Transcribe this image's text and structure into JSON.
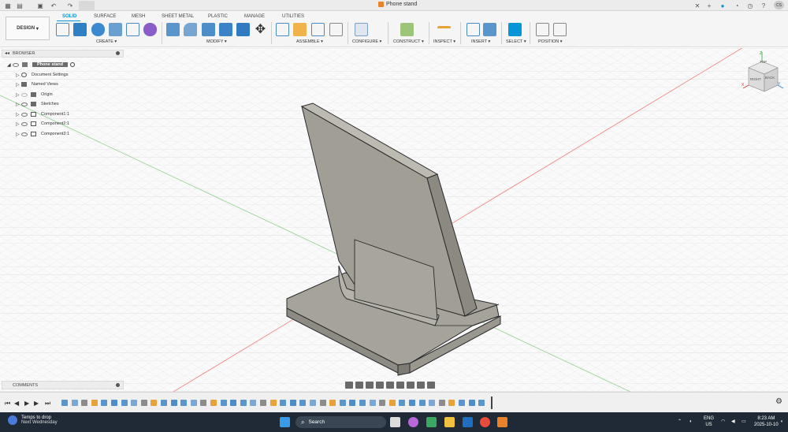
{
  "window": {
    "doc_title": "Phone stand",
    "user_initials": "CS"
  },
  "toolbar": {
    "workspace": "DESIGN",
    "tabs": [
      {
        "label": "SOLID",
        "active": true
      },
      {
        "label": "SURFACE"
      },
      {
        "label": "MESH"
      },
      {
        "label": "SHEET METAL"
      },
      {
        "label": "PLASTIC"
      },
      {
        "label": "MANAGE"
      },
      {
        "label": "UTILITIES"
      }
    ],
    "groups": [
      "CREATE",
      "MODIFY",
      "ASSEMBLE",
      "CONFIGURE",
      "CONSTRUCT",
      "INSPECT",
      "INSERT",
      "SELECT",
      "POSITION"
    ]
  },
  "browser": {
    "title": "BROWSER",
    "root": "Phone stand",
    "items": [
      "Document Settings",
      "Named Views",
      "Origin",
      "Sketches",
      "Component1:1",
      "Component2:1",
      "Component3:1"
    ]
  },
  "viewcube": {
    "front": "RIGHT",
    "back": "BACK",
    "top": "TOP"
  },
  "comments": {
    "title": "COMMENTS"
  },
  "taskbar": {
    "weather_title": "Temps to drop",
    "weather_sub": "Next Wednesday",
    "search_label": "Search",
    "lang": "ENG",
    "region": "US",
    "time": "8:23 AM",
    "date": "2025-10-10"
  },
  "colors": {
    "accent": "#0696d7",
    "body_fill": "#a19e96",
    "taskbar": "#1f2a36"
  }
}
